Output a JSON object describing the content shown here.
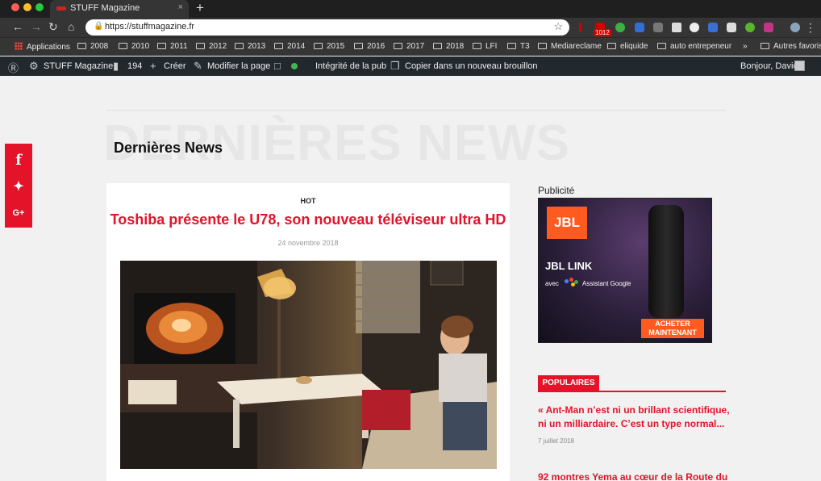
{
  "browser": {
    "tab_title": "STUFF Magazine",
    "tab_close": "×",
    "new_tab": "+",
    "url": "https://stuffmagazine.fr",
    "mail_badge": "1012"
  },
  "bookmarks": [
    {
      "label": "Applications",
      "kind": "apps"
    },
    {
      "label": "2008",
      "kind": "folder"
    },
    {
      "label": "2010",
      "kind": "folder"
    },
    {
      "label": "2011",
      "kind": "folder"
    },
    {
      "label": "2012",
      "kind": "folder"
    },
    {
      "label": "2013",
      "kind": "folder"
    },
    {
      "label": "2014",
      "kind": "folder"
    },
    {
      "label": "2015",
      "kind": "folder"
    },
    {
      "label": "2016",
      "kind": "folder"
    },
    {
      "label": "2017",
      "kind": "folder"
    },
    {
      "label": "2018",
      "kind": "folder"
    },
    {
      "label": "LFI",
      "kind": "folder"
    },
    {
      "label": "T3",
      "kind": "folder"
    },
    {
      "label": "Mediareclame",
      "kind": "folder"
    },
    {
      "label": "eliquide",
      "kind": "folder"
    },
    {
      "label": "auto entrepeneur",
      "kind": "folder"
    },
    {
      "label": "»",
      "kind": "more"
    },
    {
      "label": "Autres favoris",
      "kind": "folder"
    }
  ],
  "adminbar": {
    "site_name": "STUFF Magazine",
    "comments_count": "194",
    "create": "Créer",
    "edit_page": "Modifier la page",
    "ad_integrity": "Intégrité de la pub",
    "copy_draft": "Copier dans un nouveau brouillon",
    "greeting": "Bonjour, David"
  },
  "page": {
    "ghost_title": "DERNIÈRES NEWS",
    "section_title": "Dernières News"
  },
  "article": {
    "tag": "HOT",
    "title": "Toshiba présente le U78, son nouveau téléviseur ultra HD",
    "date": "24 novembre 2018"
  },
  "sidebar": {
    "ad_label": "Publicité",
    "ad": {
      "brand": "JBL",
      "product": "JBL LINK",
      "avec": "avec",
      "assistant": "Assistant Google",
      "cta_line1": "ACHETER",
      "cta_line2": "MAINTENANT"
    },
    "popular_heading": "POPULAIRES",
    "popular": [
      {
        "title": "« Ant-Man n’est ni un brillant scientifique, ni un milliardaire. C’est un type normal...",
        "date": "7 juillet 2018"
      },
      {
        "title": "92 montres Yema au cœur de la Route du",
        "date": ""
      }
    ]
  },
  "colors": {
    "accent_red": "#e4132a",
    "jbl_orange": "#ff5a1f",
    "adminbar": "#23282d"
  }
}
